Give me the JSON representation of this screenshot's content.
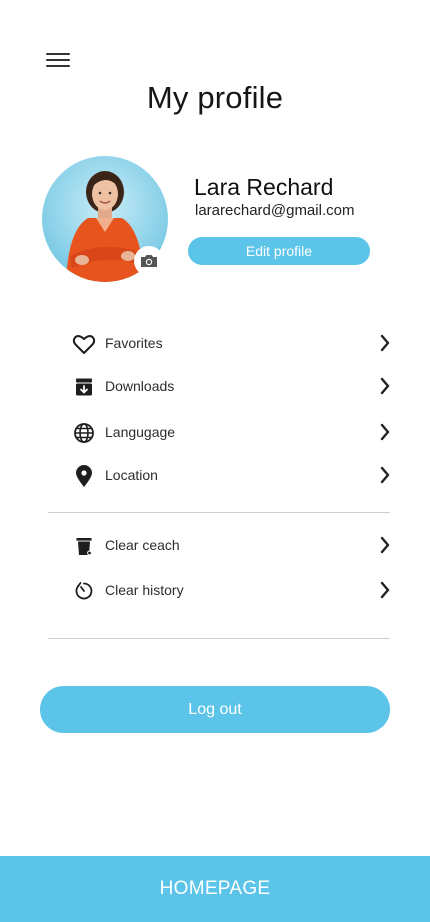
{
  "header": {
    "title": "My profile",
    "menu_icon": "hamburger-menu-icon"
  },
  "profile": {
    "name": "Lara Rechard",
    "email": "lararechard@gmail.com",
    "edit_label": "Edit profile",
    "camera_icon": "camera-icon"
  },
  "menu": {
    "group1": [
      {
        "label": "Favorites",
        "icon": "heart-icon"
      },
      {
        "label": "Downloads",
        "icon": "download-box-icon"
      },
      {
        "label": "Langugage",
        "icon": "globe-icon"
      },
      {
        "label": "Location",
        "icon": "location-pin-icon"
      }
    ],
    "group2": [
      {
        "label": "Clear ceach",
        "icon": "trash-icon"
      },
      {
        "label": "Clear history",
        "icon": "history-timer-icon"
      }
    ]
  },
  "logout_label": "Log out",
  "bottom_nav": {
    "label": "HOMEPAGE"
  },
  "colors": {
    "accent": "#5bc4e8",
    "text": "#1b1b1b",
    "divider": "#cfcfcf"
  }
}
